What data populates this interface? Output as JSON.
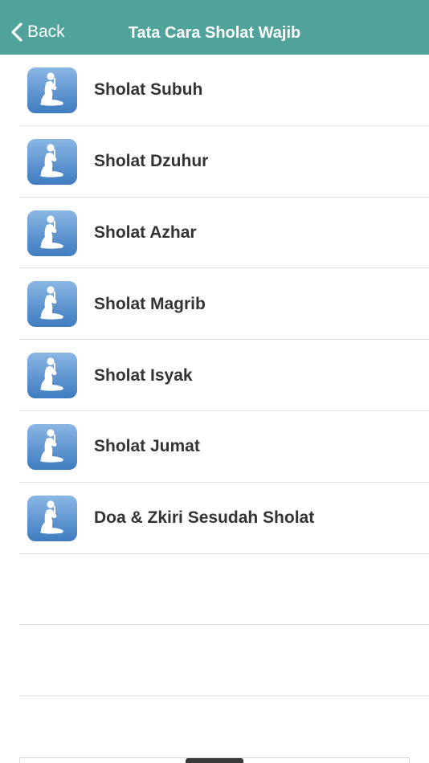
{
  "header": {
    "back_label": "Back",
    "title": "Tata Cara Sholat Wajib"
  },
  "colors": {
    "header_bg": "#4fa39a",
    "icon_gradient_top": "#8ab7e5",
    "icon_gradient_bottom": "#3f7cc0",
    "text": "#333333"
  },
  "items": [
    {
      "label": "Sholat Subuh",
      "icon": "praying-person-icon"
    },
    {
      "label": "Sholat Dzuhur",
      "icon": "praying-person-icon"
    },
    {
      "label": "Sholat Azhar",
      "icon": "praying-person-icon"
    },
    {
      "label": "Sholat Magrib",
      "icon": "praying-person-icon"
    },
    {
      "label": "Sholat Isyak",
      "icon": "praying-person-icon"
    },
    {
      "label": "Sholat Jumat",
      "icon": "praying-person-icon"
    },
    {
      "label": "Doa & Zkiri Sesudah Sholat",
      "icon": "praying-person-icon"
    }
  ]
}
